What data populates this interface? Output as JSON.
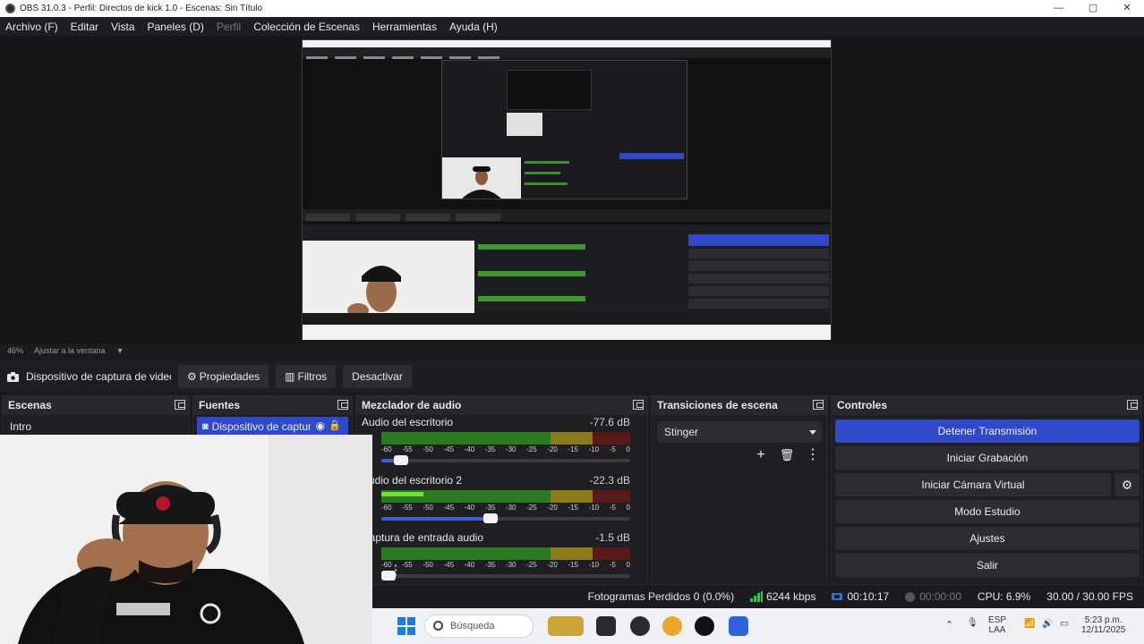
{
  "window": {
    "title": "OBS 31.0.3 - Perfil: Directos de kick 1.0 - Escenas: Sin Título",
    "minimize": "—",
    "maximize": "▢",
    "close": "✕"
  },
  "menu": [
    {
      "label": "Archivo (F)",
      "enabled": true
    },
    {
      "label": "Editar",
      "enabled": true
    },
    {
      "label": "Vista",
      "enabled": true
    },
    {
      "label": "Paneles (D)",
      "enabled": true
    },
    {
      "label": "Perfil",
      "enabled": false
    },
    {
      "label": "Colección de Escenas",
      "enabled": true
    },
    {
      "label": "Herramientas",
      "enabled": true
    },
    {
      "label": "Ayuda (H)",
      "enabled": true
    }
  ],
  "scale": {
    "zoom": "46%",
    "mode": "Ajustar a la ventana"
  },
  "source_toolbar": {
    "source_name": "Dispositivo de captura de video",
    "properties": "Propiedades",
    "filters": "Filtros",
    "deactivate": "Desactivar"
  },
  "docks": {
    "scenes": {
      "title": "Escenas",
      "items": [
        "Intro"
      ]
    },
    "sources": {
      "title": "Fuentes",
      "items": [
        {
          "label": "Dispositivo de captura de video"
        }
      ]
    },
    "mixer": {
      "title": "Mezclador de audio",
      "tracks": [
        {
          "name": "Audio del escritorio",
          "db": "-77.6 dB",
          "level": 0.0,
          "volume": 0.08
        },
        {
          "name": "Audio del escritorio 2",
          "db": "-22.3 dB",
          "level": 0.17,
          "volume": 0.44
        },
        {
          "name": "Captura de entrada audio",
          "db": "-1.5 dB",
          "level": 0.0,
          "volume": 0.0
        }
      ],
      "ticks": [
        "-60",
        "-55",
        "-50",
        "-45",
        "-40",
        "-35",
        "-30",
        "-25",
        "-20",
        "-15",
        "-10",
        "-5",
        "0"
      ]
    },
    "transitions": {
      "title": "Transiciones de escena",
      "selected": "Stinger",
      "add": "+",
      "remove": "🗑",
      "more": "⋮"
    },
    "controls": {
      "title": "Controles",
      "stop_stream": "Detener Transmisión",
      "start_record": "Iniciar Grabación",
      "virtual_cam": "Iniciar Cámara Virtual",
      "studio_mode": "Modo Estudio",
      "settings": "Ajustes",
      "exit": "Salir",
      "gear": "⚙"
    }
  },
  "status": {
    "dropped": "Fotogramas Perdidos 0 (0.0%)",
    "bitrate": "6244 kbps",
    "stream_time": "00:10:17",
    "record_time": "00:00:00",
    "cpu": "CPU: 6.9%",
    "fps": "30.00 / 30.00 FPS"
  },
  "taskbar": {
    "search_placeholder": "Búsqueda",
    "lang_top": "ESP",
    "lang_bottom": "LAA",
    "time": "5:23 p.m.",
    "date": "12/11/2025"
  },
  "colors": {
    "accent": "#2f49c9",
    "bg": "#1b1b1f",
    "meter_green": "#2c7a1f",
    "meter_yellow": "#8a7a1c",
    "meter_red": "#5a1818"
  }
}
